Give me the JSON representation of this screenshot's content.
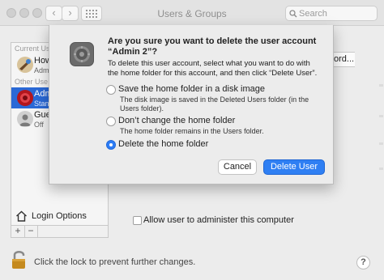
{
  "window": {
    "title": "Users & Groups"
  },
  "toolbar": {
    "back_icon": "chevron-left",
    "forward_icon": "chevron-right",
    "grid_icon": "grid-dots"
  },
  "search": {
    "placeholder": "Search"
  },
  "sidebar": {
    "current_group": "Current Us",
    "other_group": "Other Use",
    "users": [
      {
        "name": "How",
        "role": "Admin"
      },
      {
        "name": "Adm",
        "role": "Stan",
        "selected": true
      },
      {
        "name": "Gue",
        "role": "Off"
      }
    ],
    "login_options": "Login Options",
    "add_label": "+",
    "remove_label": "−"
  },
  "main": {
    "password_button_fragment": "ord...",
    "allow_admin_label": "Allow user to administer this computer",
    "allow_admin_checked": false
  },
  "footer": {
    "lock_text": "Click the lock to prevent further changes.",
    "help_label": "?"
  },
  "dialog": {
    "title": "Are you sure you want to delete the user account “Admin 2”?",
    "message": "To delete this user account, select what you want to do with the home folder for this account, and then click “Delete User”.",
    "options": [
      {
        "label": "Save the home folder in a disk image",
        "description": "The disk image is saved in the Deleted Users folder (in the Users folder).",
        "selected": false
      },
      {
        "label": "Don’t change the home folder",
        "description": "The home folder remains in the Users folder.",
        "selected": false
      },
      {
        "label": "Delete the home folder",
        "description": "",
        "selected": true
      }
    ],
    "cancel_label": "Cancel",
    "confirm_label": "Delete User"
  },
  "colors": {
    "accent": "#2f7ff3",
    "selection": "#2a69d6"
  }
}
